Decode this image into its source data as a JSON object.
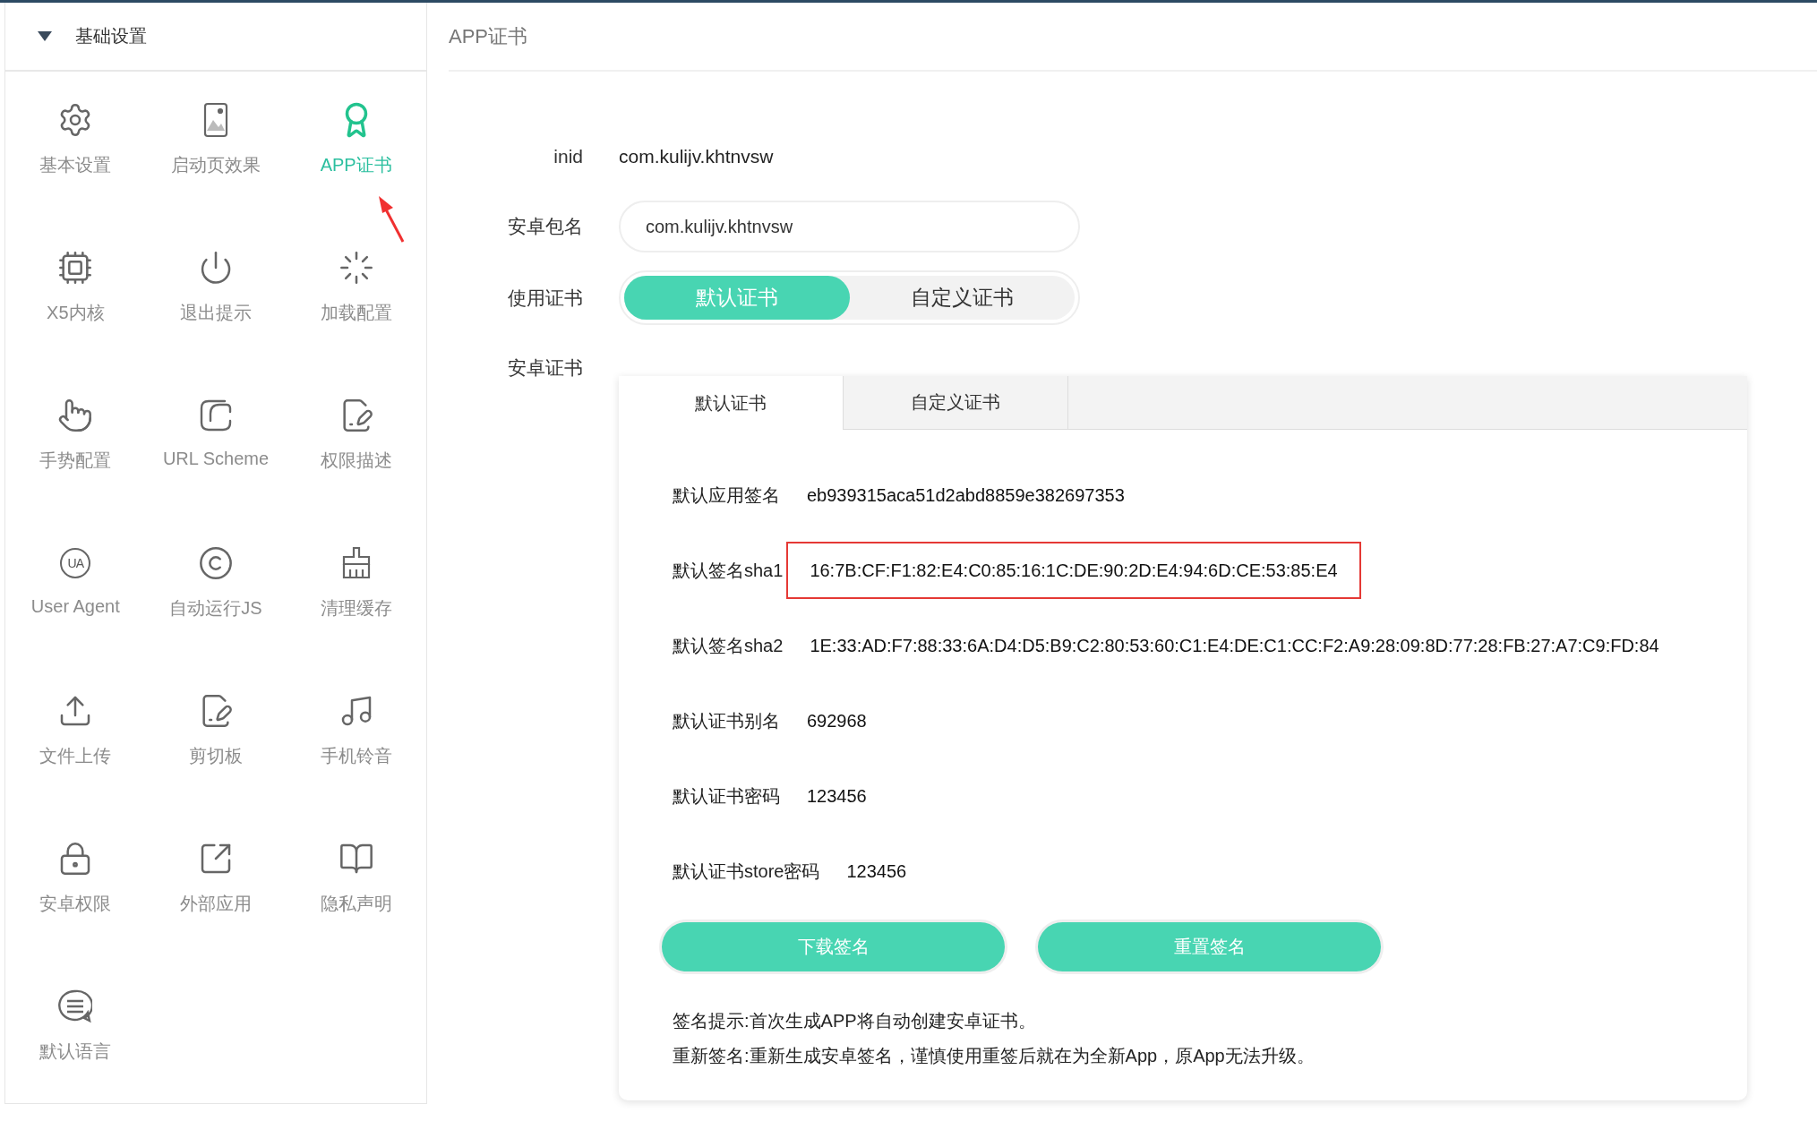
{
  "sidebar": {
    "header": {
      "title": "基础设置",
      "expanded": true
    },
    "items": [
      {
        "label": "基本设置",
        "kind": "gear",
        "selected": false
      },
      {
        "label": "启动页效果",
        "kind": "phone",
        "selected": false
      },
      {
        "label": "APP证书",
        "kind": "award",
        "selected": true
      },
      {
        "label": "X5内核",
        "kind": "chip",
        "selected": false
      },
      {
        "label": "退出提示",
        "kind": "power",
        "selected": false
      },
      {
        "label": "加载配置",
        "kind": "loader",
        "selected": false
      },
      {
        "label": "手势配置",
        "kind": "hand",
        "selected": false
      },
      {
        "label": "URL Scheme",
        "kind": "scheme",
        "selected": false
      },
      {
        "label": "权限描述",
        "kind": "document",
        "selected": false
      },
      {
        "label": "User Agent",
        "kind": "agent",
        "icon_text": "UA",
        "selected": false
      },
      {
        "label": "自动运行JS",
        "kind": "copyright",
        "selected": false
      },
      {
        "label": "清理缓存",
        "kind": "broom",
        "selected": false
      },
      {
        "label": "文件上传",
        "kind": "upload",
        "selected": false
      },
      {
        "label": "剪切板",
        "kind": "document",
        "selected": false
      },
      {
        "label": "手机铃音",
        "kind": "music",
        "selected": false
      },
      {
        "label": "安卓权限",
        "kind": "lock",
        "selected": false
      },
      {
        "label": "外部应用",
        "kind": "external",
        "selected": false
      },
      {
        "label": "隐私声明",
        "kind": "book",
        "selected": false
      },
      {
        "label": "默认语言",
        "kind": "chat",
        "selected": false
      }
    ]
  },
  "page_title": "APP证书",
  "form": {
    "inid": {
      "label": "inid",
      "value": "com.kulijv.khtnvsw"
    },
    "package": {
      "label": "安卓包名",
      "value": "com.kulijv.khtnvsw"
    },
    "certificate_choice": {
      "label": "使用证书",
      "options": [
        {
          "label": "默认证书",
          "selected": true
        },
        {
          "label": "自定义证书",
          "selected": false
        }
      ]
    },
    "android_cert": {
      "label": "安卓证书",
      "tabs": [
        {
          "label": "默认证书",
          "selected": true
        },
        {
          "label": "自定义证书",
          "selected": false
        }
      ],
      "rows": [
        {
          "label": "默认应用签名",
          "value": "eb939315aca51d2abd8859e382697353",
          "highlighted": false
        },
        {
          "label": "默认签名sha1",
          "value": "16:7B:CF:F1:82:E4:C0:85:16:1C:DE:90:2D:E4:94:6D:CE:53:85:E4",
          "highlighted": true
        },
        {
          "label": "默认签名sha2",
          "value": "1E:33:AD:F7:88:33:6A:D4:D5:B9:C2:80:53:60:C1:E4:DE:C1:CC:F2:A9:28:09:8D:77:28:FB:27:A7:C9:FD:84",
          "highlighted": false
        },
        {
          "label": "默认证书别名",
          "value": "692968",
          "highlighted": false
        },
        {
          "label": "默认证书密码",
          "value": "123456",
          "highlighted": false
        },
        {
          "label": "默认证书store密码",
          "value": "123456",
          "highlighted": false
        }
      ],
      "buttons": [
        "下载签名",
        "重置签名"
      ],
      "notes": [
        "签名提示:首次生成APP将自动创建安卓证书。",
        "重新签名:重新生成安卓签名，谨慎使用重签后就在为全新App，原App无法升级。"
      ]
    }
  }
}
